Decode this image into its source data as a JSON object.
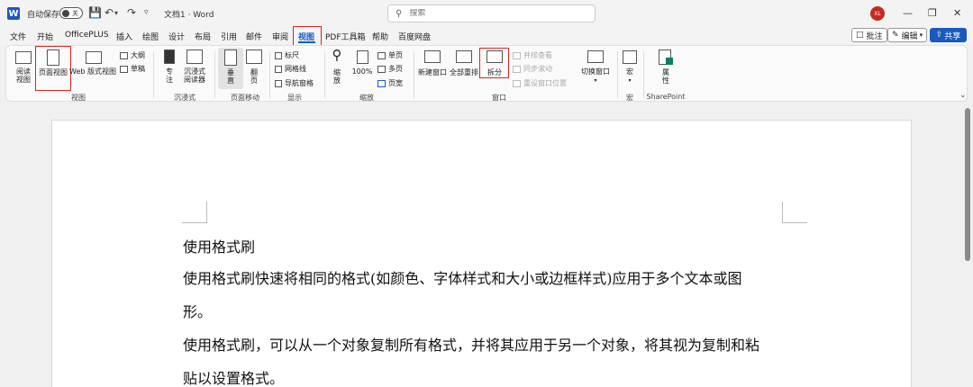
{
  "titlebar": {
    "app_logo": "W",
    "autosave_label": "自动保存",
    "autosave_state": "关",
    "doc_title": "文档1 · Word",
    "search_placeholder": "搜索",
    "avatar_initials": "XL"
  },
  "tabs": [
    "文件",
    "开始",
    "OfficePLUS",
    "插入",
    "绘图",
    "设计",
    "布局",
    "引用",
    "邮件",
    "审阅",
    "视图",
    "PDF工具箱",
    "帮助",
    "百度网盘"
  ],
  "active_tab": "视图",
  "right_buttons": {
    "comment": "批注",
    "edit": "编辑",
    "share": "共享"
  },
  "ribbon": {
    "views": {
      "read_mode": "阅读视图",
      "print_layout": "页面视图",
      "web_layout": "Web 版式视图",
      "outline": "大纲",
      "draft": "草稿",
      "label": "视图"
    },
    "immersive": {
      "focus": "专注",
      "immersive_reader": "沉浸式阅读器",
      "label": "沉浸式"
    },
    "page_movement": {
      "vertical": "垂直",
      "side_to_side": "翻页",
      "label": "页面移动"
    },
    "show": {
      "ruler": "标尺",
      "gridlines": "网格线",
      "navigation_pane": "导航窗格",
      "label": "显示"
    },
    "zoom": {
      "zoom": "缩放",
      "percent": "100%",
      "one_page": "单页",
      "multiple_pages": "多页",
      "page_width": "页宽",
      "label": "缩放"
    },
    "window": {
      "new_window": "新建窗口",
      "arrange_all": "全部重排",
      "split": "拆分",
      "side_by_side": "并排查看",
      "sync_scroll": "同步滚动",
      "reset_position": "重设窗口位置",
      "switch_windows": "切换窗口",
      "label": "窗口"
    },
    "macros": {
      "macros": "宏",
      "label": "宏"
    },
    "sharepoint": {
      "properties": "属性",
      "label": "SharePoint"
    }
  },
  "document": {
    "paragraphs": [
      "使用格式刷",
      "使用格式刷快速将相同的格式(如颜色、字体样式和大小或边框样式)应用于多个文本或图",
      "形。",
      "使用格式刷，可以从一个对象复制所有格式，并将其应用于另一个对象，将其视为复制和粘",
      "贴以设置格式。"
    ]
  },
  "colors": {
    "accent": "#185abd",
    "highlight": "#e02020",
    "avatar": "#c42b1c"
  }
}
